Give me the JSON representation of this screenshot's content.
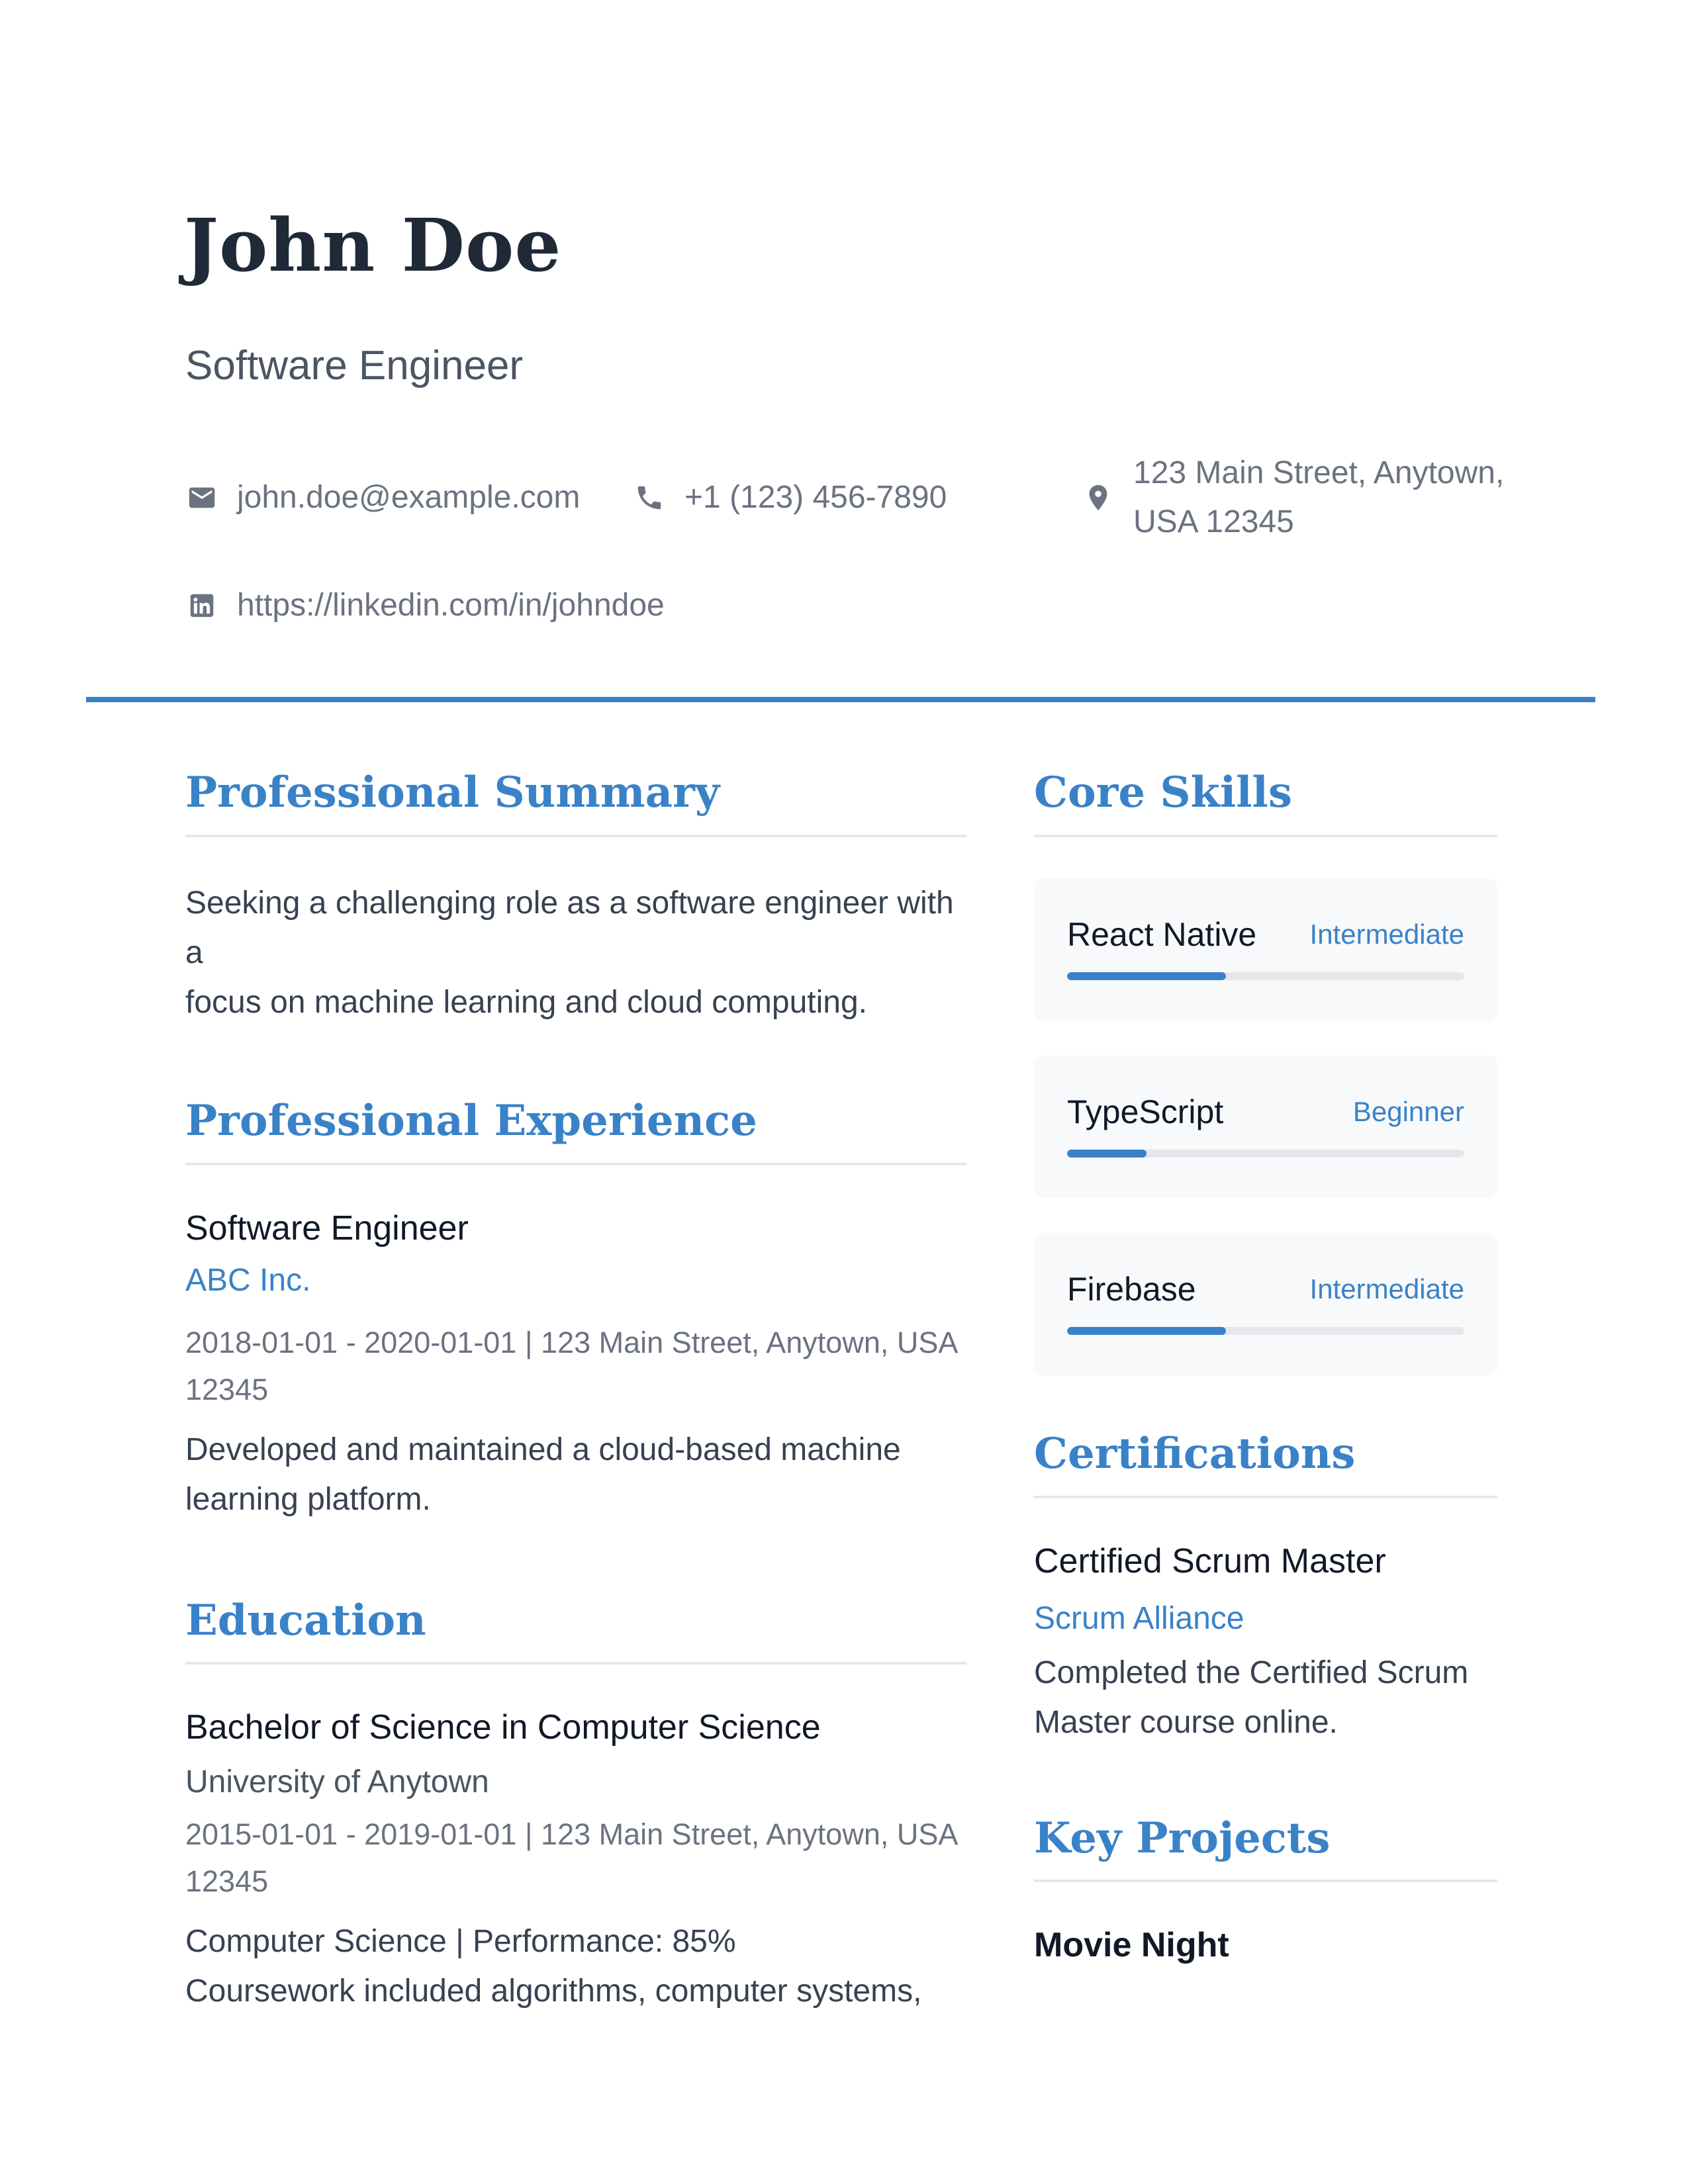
{
  "header": {
    "name": "John Doe",
    "title": "Software Engineer",
    "contact": {
      "email": "john.doe@example.com",
      "phone": "+1 (123) 456-7890",
      "address_line1": "123 Main Street, Anytown,",
      "address_line2": "USA 12345",
      "linkedin": "https://linkedin.com/in/johndoe"
    }
  },
  "summary": {
    "heading": "Professional Summary",
    "line1": "Seeking a challenging role as a software engineer with a",
    "line2": "focus on machine learning and cloud computing."
  },
  "experience": {
    "heading": "Professional Experience",
    "items": [
      {
        "role": "Software Engineer",
        "company": "ABC Inc.",
        "meta_line1": "2018-01-01 - 2020-01-01 | 123 Main Street, Anytown, USA",
        "meta_line2": "12345",
        "desc_line1": "Developed and maintained a cloud-based machine",
        "desc_line2": "learning platform."
      }
    ]
  },
  "education": {
    "heading": "Education",
    "items": [
      {
        "degree": "Bachelor of Science in Computer Science",
        "school": "University of Anytown",
        "meta_line1": "2015-01-01 - 2019-01-01 | 123 Main Street, Anytown, USA",
        "meta_line2": "12345",
        "desc_line1": "Computer Science | Performance: 85%",
        "desc_line2": "Coursework included algorithms, computer systems,"
      }
    ]
  },
  "skills": {
    "heading": "Core Skills",
    "items": [
      {
        "name": "React Native",
        "level": "Intermediate",
        "progress": 0.4
      },
      {
        "name": "TypeScript",
        "level": "Beginner",
        "progress": 0.2
      },
      {
        "name": "Firebase",
        "level": "Intermediate",
        "progress": 0.4
      }
    ]
  },
  "certifications": {
    "heading": "Certifications",
    "items": [
      {
        "name": "Certified Scrum Master",
        "issuer": "Scrum Alliance",
        "desc_line1": "Completed the Certified Scrum",
        "desc_line2": "Master course online."
      }
    ]
  },
  "projects": {
    "heading": "Key Projects",
    "items": [
      {
        "name": "Movie Night"
      }
    ]
  },
  "icons": {
    "email": "email-icon",
    "phone": "phone-icon",
    "location": "location-pin-icon",
    "linkedin": "linkedin-icon"
  },
  "colors": {
    "accent": "#3a82c8",
    "name": "#1f2937",
    "muted": "#6b7280",
    "body": "#374151"
  }
}
